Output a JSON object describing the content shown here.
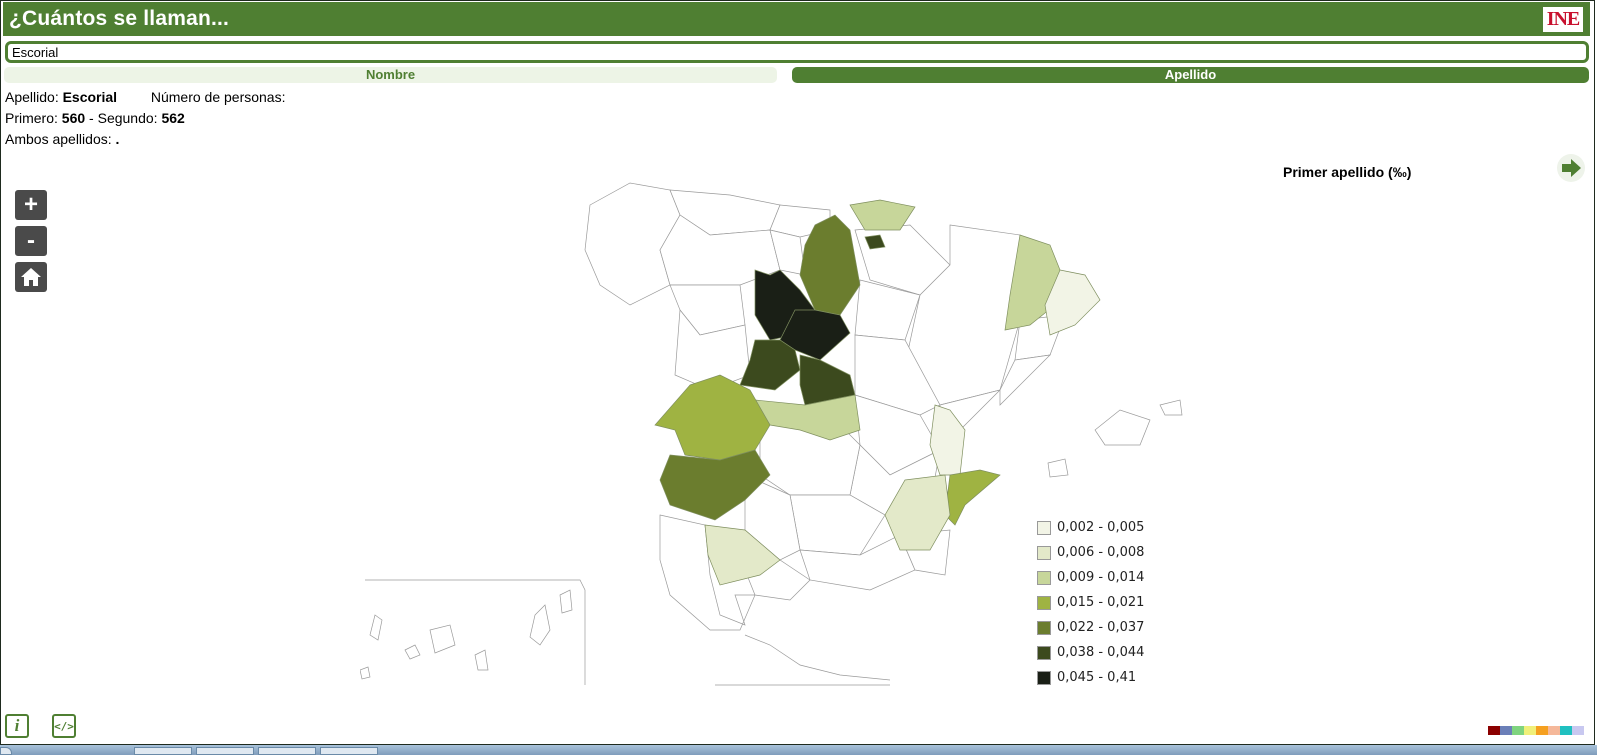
{
  "header": {
    "title": "¿Cuántos se llaman...",
    "logo_text": "INE"
  },
  "search": {
    "value": "Escorial"
  },
  "tabs": [
    {
      "label": "Nombre",
      "active": false
    },
    {
      "label": "Apellido",
      "active": true
    }
  ],
  "info": {
    "surname_label": "Apellido:",
    "surname_value": "Escorial",
    "people_label": "Número de personas:",
    "first_label": "Primero:",
    "first_value": "560",
    "separator": "-",
    "second_label": "Segundo:",
    "second_value": "562",
    "both_label": "Ambos apellidos:",
    "both_value": "."
  },
  "map_controls": {
    "zoom_in": "+",
    "zoom_out": "-"
  },
  "map": {
    "title": "Primer apellido (‰)"
  },
  "legend": [
    {
      "label": "0,002 - 0,005",
      "color": "#f2f4e6"
    },
    {
      "label": "0,006 - 0,008",
      "color": "#e3e9c9"
    },
    {
      "label": "0,009 - 0,014",
      "color": "#c7d69a"
    },
    {
      "label": "0,015 - 0,021",
      "color": "#9fb342"
    },
    {
      "label": "0,022 - 0,037",
      "color": "#6b7d2e"
    },
    {
      "label": "0,038 - 0,044",
      "color": "#3c4a1e"
    },
    {
      "label": "0,045 - 0,41",
      "color": "#1a1f16"
    }
  ],
  "bottom": {
    "info_icon": "i",
    "embed_icon": "</>"
  },
  "palette": [
    "#8b0000",
    "#6b7fb8",
    "#7fd47f",
    "#f0f07a",
    "#f5a020",
    "#f5b89a",
    "#20c0c0",
    "#c8c8f0"
  ]
}
